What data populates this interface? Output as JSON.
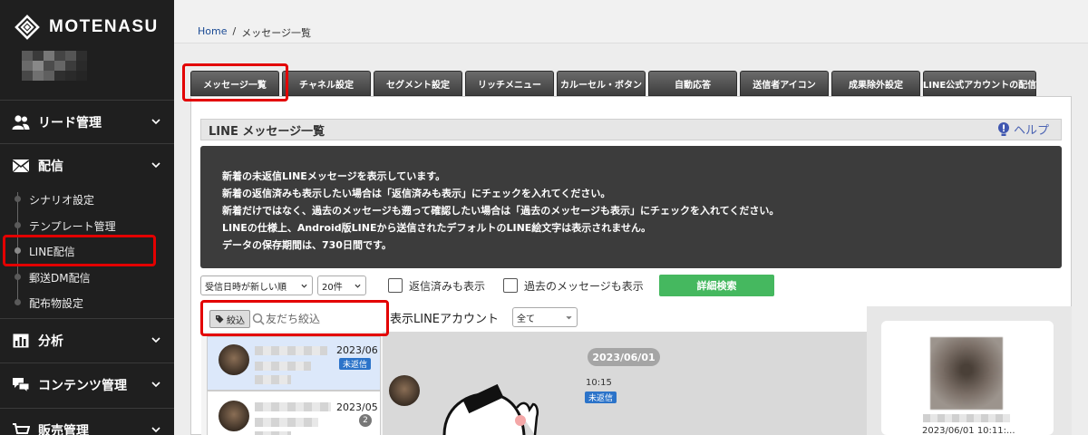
{
  "app": {
    "brand": "MOTENASU"
  },
  "sidebar": {
    "sections": [
      {
        "label": "リード管理",
        "icon": "users-icon"
      },
      {
        "label": "配信",
        "icon": "envelope-icon"
      },
      {
        "label": "分析",
        "icon": "bar-chart-icon"
      },
      {
        "label": "コンテンツ管理",
        "icon": "chat-bubbles-icon"
      },
      {
        "label": "販売管理",
        "icon": "cart-icon"
      }
    ],
    "sub_items": [
      {
        "label": "シナリオ設定"
      },
      {
        "label": "テンプレート管理"
      },
      {
        "label": "LINE配信"
      },
      {
        "label": "郵送DM配信"
      },
      {
        "label": "配布物設定"
      }
    ]
  },
  "breadcrumb": {
    "home": "Home",
    "sep": "/",
    "current": "メッセージ一覧"
  },
  "tabs": [
    "メッセージ一覧",
    "チャネル設定",
    "セグメント設定",
    "リッチメニュー",
    "カルーセル・ボタン",
    "自動応答",
    "送信者アイコン",
    "成果除外設定",
    "LINE公式アカウントの配信"
  ],
  "panel": {
    "title": "LINE メッセージ一覧",
    "help_label": "ヘルプ",
    "notice_lines": [
      "新着の未返信LINEメッセージを表示しています。",
      "新着の返信済みも表示したい場合は「返信済みも表示」にチェックを入れてください。",
      "新着だけではなく、過去のメッセージも遡って確認したい場合は「過去のメッセージも表示」にチェックを入れてください。",
      "LINEの仕様上、Android版LINEから送信されたデフォルトのLINE絵文字は表示されません。",
      "データの保存期間は、730日間です。"
    ]
  },
  "filters": {
    "sort": "受信日時が新しい順",
    "count": "20件",
    "show_replied": "返信済みも表示",
    "show_past": "過去のメッセージも表示",
    "detail_search": "詳細検索",
    "tag_filter": "絞込",
    "friend_placeholder": "友だち絞込",
    "account_label": "表示LINEアカウント",
    "account_value": "全て"
  },
  "conversations": [
    {
      "date": "2023/06",
      "status": "未返信"
    },
    {
      "date": "2023/05",
      "badge": "2"
    }
  ],
  "chat": {
    "date_pill": "2023/06/01",
    "time": "10:15",
    "status": "未返信"
  },
  "profile": {
    "date": "2023/06/01 10:11:..."
  },
  "colors": {
    "sidebar_bg": "#1f1f1f",
    "accent_green": "#45b85f",
    "unreplied_blue": "#2b73c9",
    "highlight_red": "#e30000"
  }
}
